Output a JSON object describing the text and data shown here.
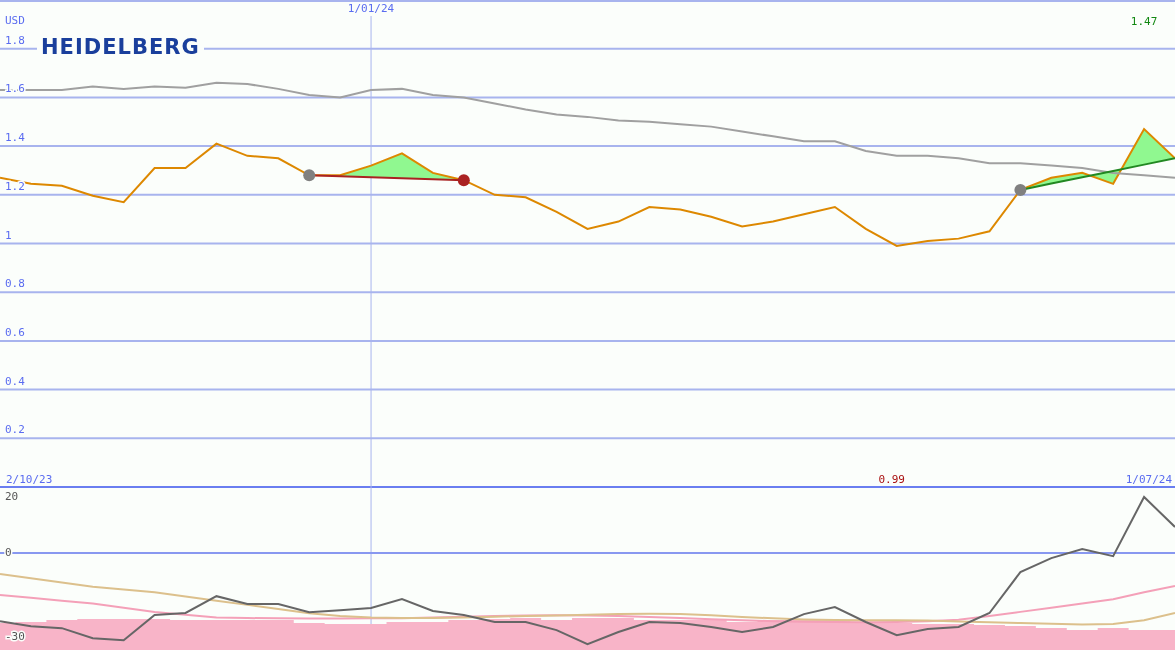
{
  "logo": "HEIDELBERG",
  "price_chart": {
    "dates": [
      {
        "kind": "start",
        "text": "2/10/23"
      },
      {
        "kind": "marker",
        "text": "1/01/24"
      },
      {
        "kind": "end",
        "text": "1/07/24"
      }
    ],
    "chart_data": {
      "type": "line",
      "ylabel": "USD",
      "grid": true,
      "ylim": [
        0,
        2
      ],
      "categories": [
        null,
        null,
        null,
        null,
        null,
        null,
        null,
        null,
        null,
        null,
        null,
        null,
        null,
        null,
        null,
        null,
        null,
        null,
        null,
        null,
        null,
        null,
        null,
        null,
        null,
        null,
        null,
        null,
        null,
        null,
        null,
        null,
        null,
        null,
        null,
        null,
        null,
        null,
        null
      ],
      "yticks": [
        0.2,
        0.4,
        0.6,
        0.8,
        {
          "value": 1,
          "label": "1"
        },
        1.2,
        1.4,
        1.6,
        1.8
      ],
      "series": [
        {
          "color": "#dd8800",
          "values": [
            1.27,
            1.245,
            1.237,
            1.196,
            1.17,
            1.31,
            1.31,
            1.41,
            1.36,
            1.35,
            1.28,
            1.28,
            1.32,
            1.37,
            1.29,
            1.26,
            1.2,
            1.19,
            1.13,
            1.06,
            1.09,
            1.15,
            1.14,
            1.11,
            1.07,
            1.09,
            1.12,
            1.15,
            1.06,
            0.99,
            1.01,
            1.02,
            1.05,
            1.22,
            1.27,
            1.29,
            1.245,
            1.47,
            1.35
          ]
        },
        {
          "color": "#a0a0a0",
          "values": [
            1.63,
            1.63,
            1.63,
            1.645,
            1.635,
            1.645,
            1.64,
            1.66,
            1.655,
            1.635,
            1.61,
            1.6,
            1.63,
            1.635,
            1.61,
            1.6,
            1.575,
            1.55,
            1.53,
            1.52,
            1.505,
            1.5,
            1.49,
            1.48,
            1.46,
            1.44,
            1.42,
            1.42,
            1.38,
            1.36,
            1.36,
            1.35,
            1.33,
            1.33,
            1.32,
            1.31,
            1.29,
            1.28,
            1.27
          ]
        },
        {
          "color": "#aa2222",
          "values": [
            null,
            null,
            null,
            null,
            null,
            null,
            null,
            null,
            null,
            null,
            1.28,
            1.276,
            1.272,
            1.268,
            1.264,
            1.26,
            null,
            null,
            null,
            null,
            null,
            null,
            null,
            null,
            null,
            null,
            null,
            null,
            null,
            null,
            null,
            null,
            null,
            null,
            null,
            null,
            null,
            null,
            null
          ]
        },
        {
          "color": "#228822",
          "values": [
            null,
            null,
            null,
            null,
            null,
            null,
            null,
            null,
            null,
            null,
            null,
            null,
            null,
            null,
            null,
            null,
            null,
            null,
            null,
            null,
            null,
            null,
            null,
            null,
            null,
            null,
            null,
            null,
            null,
            null,
            null,
            null,
            null,
            1.22,
            1.246,
            1.272,
            1.298,
            1.324,
            1.35
          ]
        }
      ],
      "annotations": [
        "1.47",
        "0.99"
      ]
    }
  },
  "indicator_chart": {
    "chart_data": {
      "type": "line",
      "categories": [
        null,
        null,
        null,
        null,
        null,
        null,
        null,
        null,
        null,
        null,
        null,
        null,
        null,
        null,
        null,
        null,
        null,
        null,
        null,
        null,
        null,
        null,
        null,
        null,
        null,
        null,
        null,
        null,
        null,
        null,
        null,
        null,
        null,
        null,
        null,
        null,
        null,
        null,
        null
      ],
      "yticks": [
        -30,
        0,
        20
      ],
      "ylim": [
        -34.6,
        23.2
      ],
      "ref_lines": [
        {
          "axis": "y",
          "value": 0
        }
      ],
      "series": [
        {
          "color": "#f4a0b8",
          "values": [
            -15,
            -16,
            -17,
            -18,
            -19.5,
            -21,
            -22,
            -23,
            -23.2,
            -23.3,
            -23.4,
            -23.4,
            -23.3,
            -23.3,
            -23,
            -22.7,
            -22.5,
            -22.3,
            -22.2,
            -22.3,
            -22.5,
            -22.8,
            -23.2,
            -23.6,
            -24,
            -24.3,
            -24.5,
            -24.6,
            -24.7,
            -24.6,
            -24.3,
            -23.8,
            -22.5,
            -21,
            -19.5,
            -18,
            -16.5,
            -14,
            -11.8
          ]
        },
        {
          "color": "#dcc08c",
          "values": [
            -7.5,
            -9,
            -10.5,
            -12,
            -13,
            -14,
            -15.5,
            -17,
            -18.5,
            -20,
            -21.5,
            -22.5,
            -23,
            -23.2,
            -23.2,
            -23,
            -22.7,
            -22.5,
            -22.3,
            -22,
            -21.8,
            -21.7,
            -21.8,
            -22.2,
            -22.8,
            -23.3,
            -23.7,
            -23.9,
            -24,
            -24,
            -24.1,
            -24.4,
            -24.7,
            -25,
            -25.2,
            -25.5,
            -25.3,
            -24,
            -21.4
          ]
        },
        {
          "color": "#666666",
          "values": [
            -24.3,
            -26.1,
            -26.8,
            -30.4,
            -31.1,
            -22.1,
            -21.4,
            -15.4,
            -18.2,
            -18.2,
            -21.1,
            -20.4,
            -19.6,
            -16.4,
            -20.7,
            -22.1,
            -24.6,
            -24.6,
            -27.5,
            -32.5,
            -28.2,
            -24.6,
            -25,
            -26.4,
            -28.2,
            -26.4,
            -21.8,
            -19.3,
            -24.6,
            -29.3,
            -27.1,
            -26.4,
            -21.4,
            -6.8,
            -1.8,
            1.4,
            -1.1,
            20,
            9.3
          ]
        }
      ]
    }
  }
}
